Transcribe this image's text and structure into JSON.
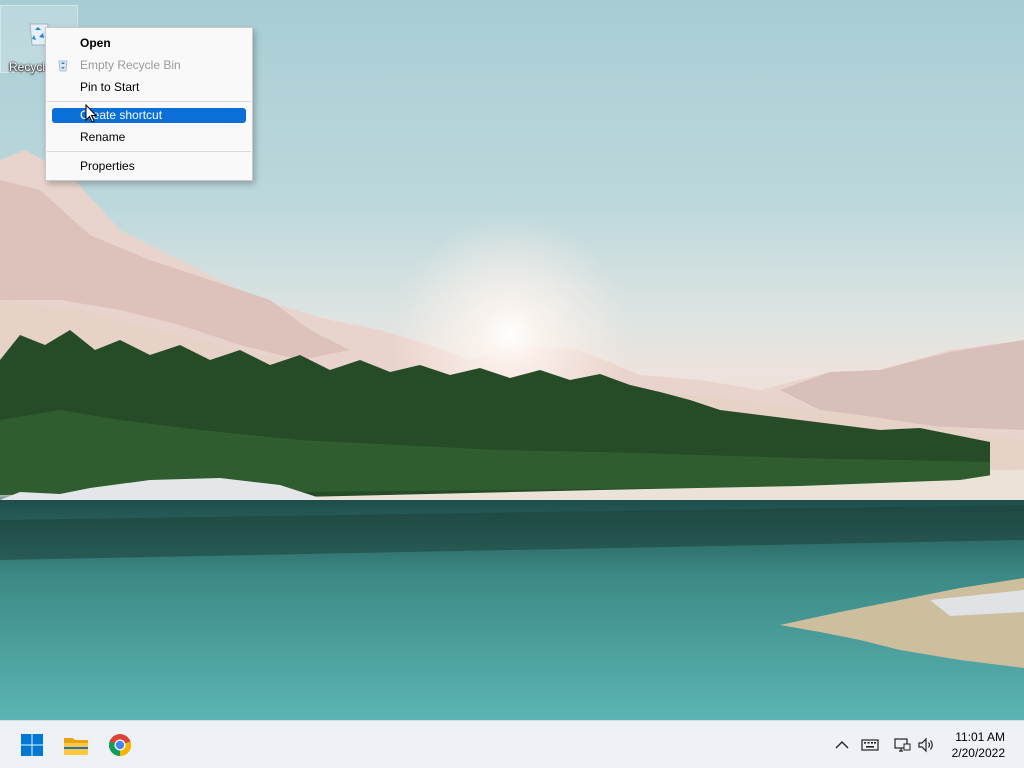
{
  "desktop": {
    "recycle_bin_label": "Recycle Bin"
  },
  "context_menu": {
    "items": [
      {
        "label": "Open",
        "style": "bold"
      },
      {
        "label": "Empty Recycle Bin",
        "style": "disabled",
        "icon": "recycle-bin-icon"
      },
      {
        "label": "Pin to Start",
        "style": "normal"
      },
      {
        "label": "Create shortcut",
        "style": "highlighted"
      },
      {
        "label": "Rename",
        "style": "normal"
      },
      {
        "label": "Properties",
        "style": "normal"
      }
    ]
  },
  "taskbar": {
    "pinned": [
      "windows-start-icon",
      "file-explorer-icon",
      "chrome-icon"
    ],
    "tray_icons": [
      "chevron-up-icon",
      "keyboard-icon",
      "network-icon",
      "volume-icon"
    ],
    "clock": {
      "time": "11:01 AM",
      "date": "2/20/2022"
    }
  },
  "colors": {
    "menu_highlight": "#0a6fd6",
    "taskbar_bg": "#eef2f6",
    "start_blue": "#0078d4"
  }
}
